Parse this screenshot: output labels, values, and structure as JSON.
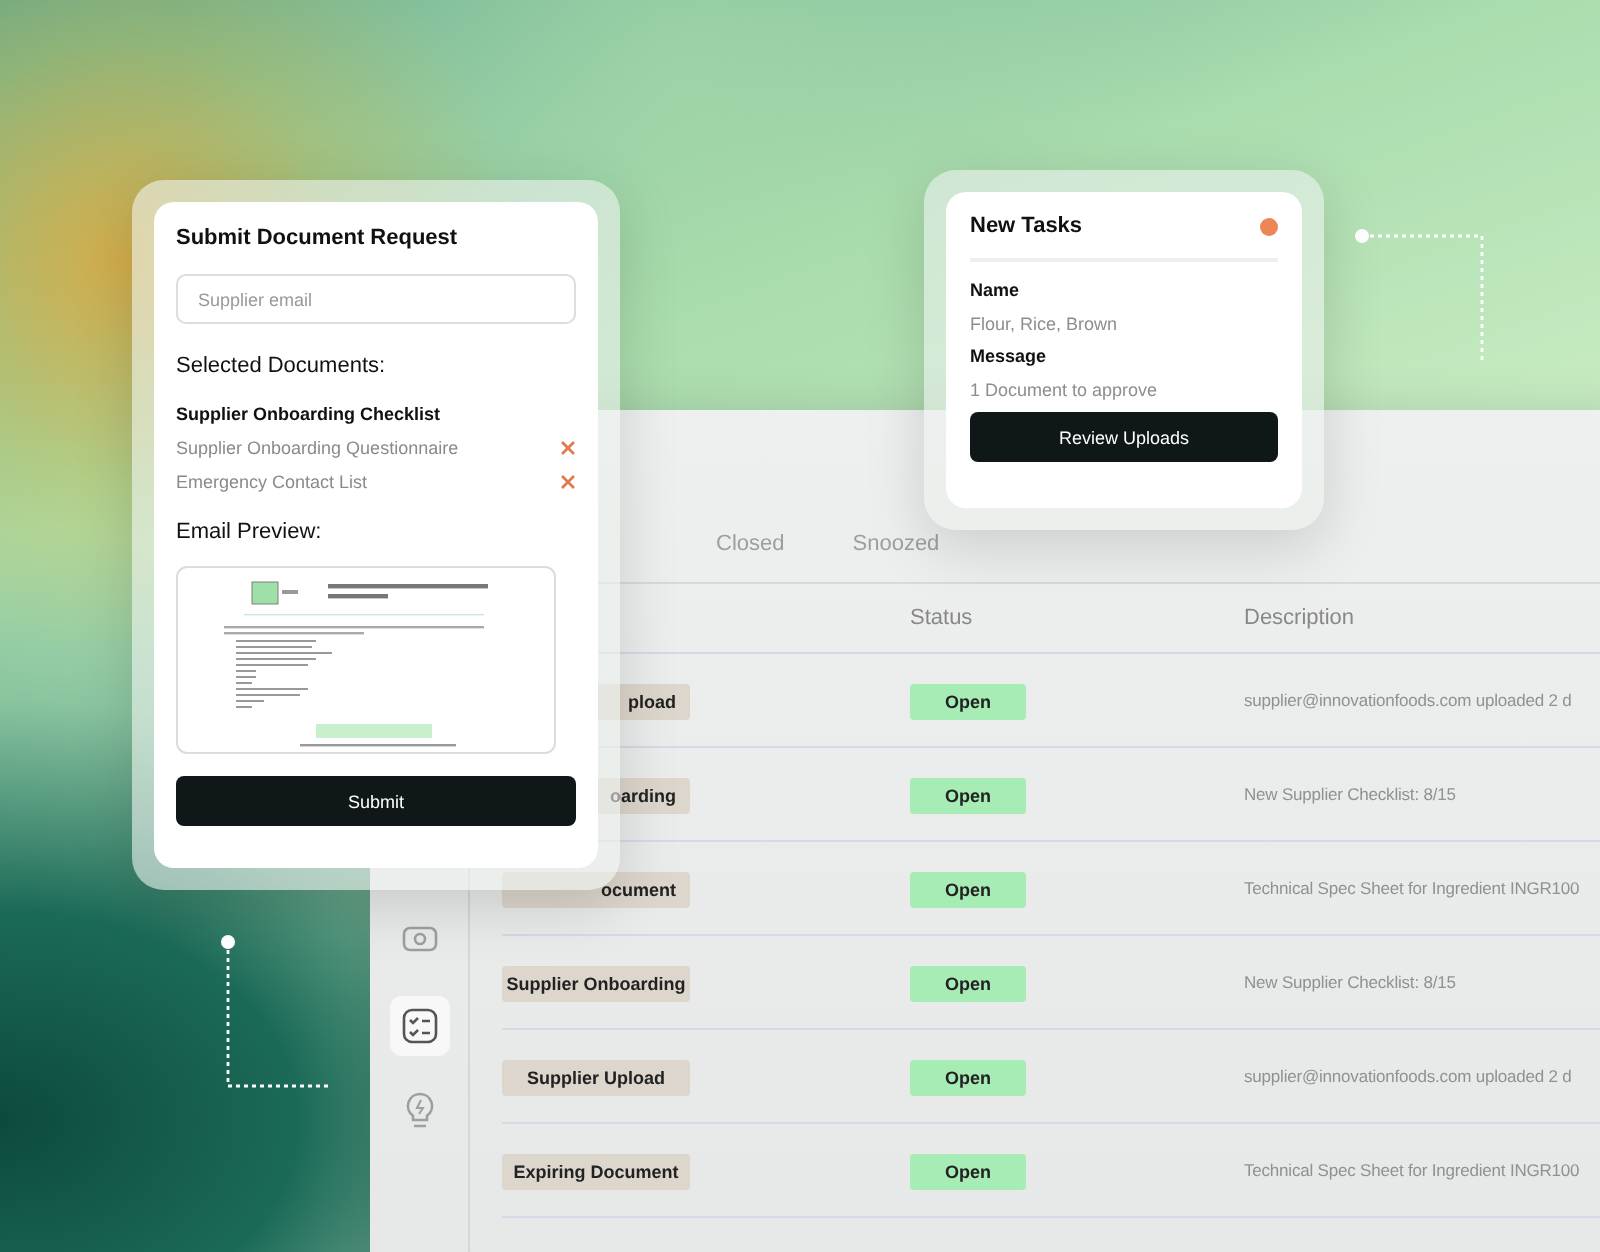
{
  "request_card": {
    "title": "Submit Document Request",
    "email_field": {
      "placeholder": "Supplier email"
    },
    "selected_heading": "Selected Documents:",
    "documents": [
      {
        "label": "Supplier Onboarding Checklist",
        "removable": false
      },
      {
        "label": "Supplier Onboarding Questionnaire",
        "removable": true
      },
      {
        "label": "Emergency Contact List",
        "removable": true
      }
    ],
    "preview_heading": "Email Preview:",
    "submit": "Submit"
  },
  "tasks_card": {
    "title": "New Tasks",
    "fields": [
      {
        "label": "Name",
        "value": "Flour, Rice, Brown"
      },
      {
        "label": "Message",
        "value": "1 Document to approve"
      }
    ],
    "button": "Review Uploads"
  },
  "dashboard": {
    "tabs": [
      {
        "label": "Closed",
        "selected": false
      },
      {
        "label": "Snoozed",
        "selected": false
      }
    ],
    "sidebar": [
      {
        "kind": "money",
        "selected": false
      },
      {
        "kind": "checklist",
        "selected": true
      },
      {
        "kind": "bulb",
        "selected": false
      }
    ],
    "columns": [
      "Status",
      "Description"
    ],
    "rows": [
      {
        "type": "pload",
        "kind": "partial",
        "status": "Open",
        "description": "supplier@innovationfoods.com uploaded 2 d"
      },
      {
        "type": "oarding",
        "kind": "partial",
        "status": "Open",
        "description": "New Supplier Checklist: 8/15"
      },
      {
        "type": "ocument",
        "kind": "partial",
        "status": "Open",
        "description": "Technical Spec Sheet for Ingredient INGR100"
      },
      {
        "type": "Supplier Onboarding",
        "kind": "full",
        "status": "Open",
        "description": "New Supplier Checklist: 8/15"
      },
      {
        "type": "Supplier Upload",
        "kind": "full",
        "status": "Open",
        "description": "supplier@innovationfoods.com uploaded 2 d"
      },
      {
        "type": "Expiring Document",
        "kind": "full",
        "status": "Open",
        "description": "Technical Spec Sheet for Ingredient INGR100"
      }
    ]
  }
}
